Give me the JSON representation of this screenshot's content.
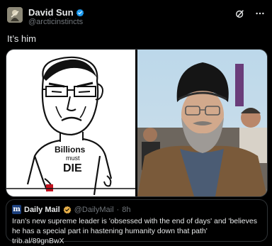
{
  "author": {
    "name": "David Sun",
    "handle": "@arcticinstincts"
  },
  "tweet": {
    "text": "It’s him"
  },
  "drawing": {
    "shirt_line1": "Billions",
    "shirt_line2": "must",
    "shirt_line3": "DIE"
  },
  "quote": {
    "logo": "m",
    "source_name": "Daily Mail",
    "source_handle": "@DailyMail",
    "separator": "·",
    "time": "8h",
    "text": "Iran's new supreme leader is 'obsessed with the end of days' and 'believes he has a special part in hastening humanity down that path' trib.al/89gnBwX"
  },
  "icons": {
    "verified": "verified-badge-icon",
    "grok": "grok-icon",
    "more": "more-icon"
  },
  "colors": {
    "background": "#000000",
    "text": "#e7e9ea",
    "muted": "#71767b",
    "verified": "#1d9bf0",
    "border": "#2f3336"
  }
}
